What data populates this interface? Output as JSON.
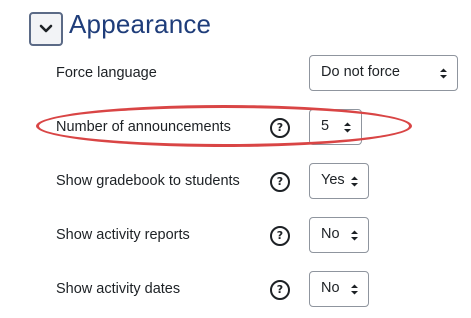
{
  "section": {
    "title": "Appearance",
    "collapse_icon": "chevron-down-icon"
  },
  "settings": [
    {
      "label": "Force language",
      "value": "Do not force",
      "help": false
    },
    {
      "label": "Number of announcements",
      "value": "5",
      "help": true,
      "help_glyph": "?"
    },
    {
      "label": "Show gradebook to students",
      "value": "Yes",
      "help": true,
      "help_glyph": "?"
    },
    {
      "label": "Show activity reports",
      "value": "No",
      "help": true,
      "help_glyph": "?"
    },
    {
      "label": "Show activity dates",
      "value": "No",
      "help": true,
      "help_glyph": "?"
    }
  ],
  "annotation": {
    "shape": "ellipse",
    "color": "#d94545",
    "highlights": "Number of announcements"
  },
  "colors": {
    "title": "#1f3d7a",
    "border": "#8f959e",
    "text": "#1d2125"
  }
}
